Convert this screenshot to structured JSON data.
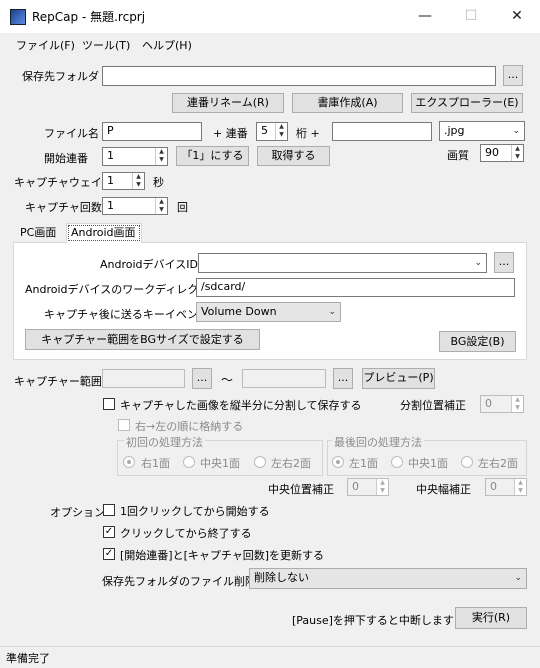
{
  "window": {
    "title": "RepCap - 無題.rcprj",
    "minimize": "—",
    "maximize": "☐",
    "close": "✕"
  },
  "menu": [
    "ファイル(F)",
    "ツール(T)",
    "ヘルプ(H)"
  ],
  "save_folder": {
    "label": "保存先フォルダ",
    "value": "",
    "browse": "..."
  },
  "actions": {
    "rename": "連番リネーム(R)",
    "doc": "書庫作成(A)",
    "explorer": "エクスプローラー(E)"
  },
  "filename": {
    "label": "ファイル名",
    "value": "P",
    "plus_serial": "+ 連番",
    "digits": "5",
    "digits_unit": "桁 +",
    "suffix": "",
    "ext": ".jpg"
  },
  "start_serial": {
    "label": "開始連番",
    "value": "1",
    "set_one": "「1」にする",
    "fetch": "取得する"
  },
  "quality": {
    "label": "画質",
    "value": "90"
  },
  "capture_wait": {
    "label": "キャプチャウェイト",
    "value": "1",
    "unit": "秒"
  },
  "capture_count": {
    "label": "キャプチャ回数",
    "value": "1",
    "unit": "回"
  },
  "tabs": {
    "pc": "PC画面",
    "android": "Android画面"
  },
  "android": {
    "device_id_label": "AndroidデバイスID",
    "device_id_value": "",
    "device_browse": "...",
    "workdir_label": "Androidデバイスのワークディレクトリ",
    "workdir_value": "/sdcard/",
    "key_label": "キャプチャ後に送るキーイベント",
    "key_value": "Volume Down",
    "bg_size_button": "キャプチャー範囲をBGサイズで設定する",
    "bg_settings": "BG設定(B)"
  },
  "range": {
    "label": "キャプチャー範囲",
    "from": "",
    "to": "",
    "browse1": "...",
    "tilde": "〜",
    "browse2": "...",
    "preview": "プレビュー(P)"
  },
  "split": {
    "label": "キャプチャした画像を縦半分に分割して保存する",
    "pos_label": "分割位置補正",
    "pos_value": "0",
    "rtl": "右→左の順に格納する"
  },
  "first": {
    "title": "初回の処理方法",
    "opts": [
      "右1面",
      "中央1面",
      "左右2面"
    ]
  },
  "last": {
    "title": "最後回の処理方法",
    "opts": [
      "左1面",
      "中央1面",
      "左右2面"
    ]
  },
  "center": {
    "pos_label": "中央位置補正",
    "pos_value": "0",
    "width_label": "中央幅補正",
    "width_value": "0"
  },
  "options": {
    "label": "オプション",
    "opt1": "1回クリックしてから開始する",
    "opt2": "クリックしてから終了する",
    "opt3": "[開始連番]と[キャプチャ回数]を更新する",
    "delete_label": "保存先フォルダのファイル削除",
    "delete_value": "削除しない",
    "check": "✓"
  },
  "footer": {
    "hint": "[Pause]を押下すると中断します.",
    "run": "実行(R)"
  },
  "status": "準備完了"
}
